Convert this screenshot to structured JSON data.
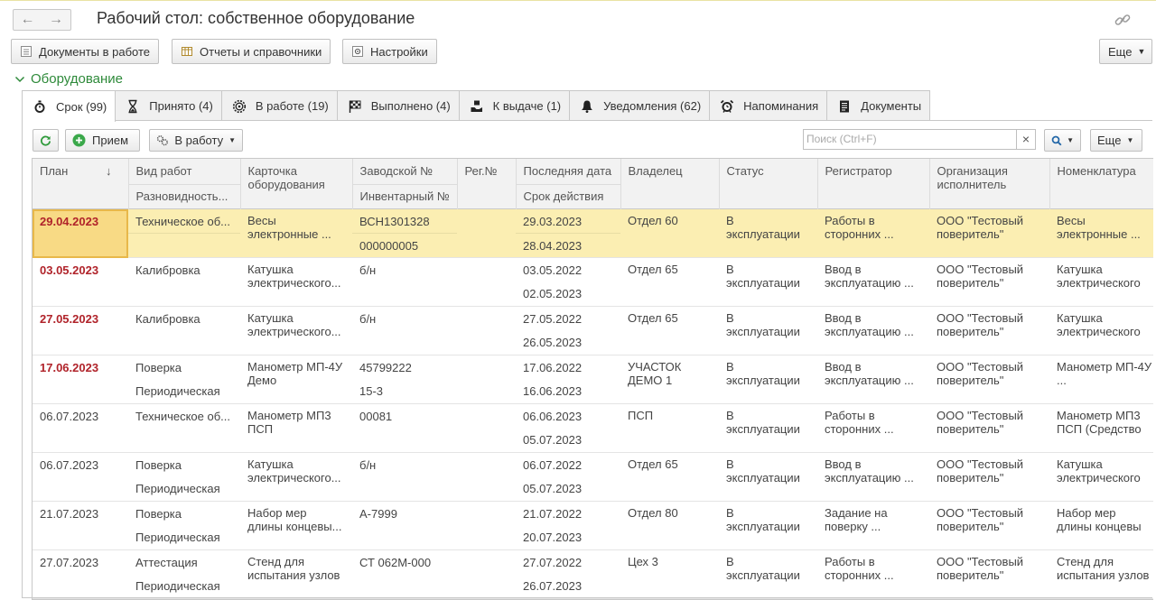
{
  "window": {
    "title": "Рабочий стол: собственное оборудование"
  },
  "toolbar": {
    "docs_in_work": "Документы в работе",
    "reports": "Отчеты и справочники",
    "settings": "Настройки",
    "more": "Еще"
  },
  "section": {
    "title": "Оборудование"
  },
  "tabs": [
    {
      "label": "Срок (99)",
      "icon": "stopwatch-icon"
    },
    {
      "label": "Принято (4)",
      "icon": "hourglass-icon"
    },
    {
      "label": "В работе (19)",
      "icon": "gear-icon"
    },
    {
      "label": "Выполнено (4)",
      "icon": "checkered-flag-icon"
    },
    {
      "label": "К выдаче (1)",
      "icon": "handover-icon"
    },
    {
      "label": "Уведомления (62)",
      "icon": "bell-icon"
    },
    {
      "label": "Напоминания",
      "icon": "alarm-clock-icon"
    },
    {
      "label": "Документы",
      "icon": "document-icon"
    }
  ],
  "panel_toolbar": {
    "receive": "Прием",
    "to_work": "В работу",
    "search_placeholder": "Поиск (Ctrl+F)",
    "search_clear": "×",
    "more": "Еще"
  },
  "columns": {
    "plan": "План",
    "work_type": "Вид работ",
    "work_variety": "Разновидность...",
    "card": "Карточка оборудования",
    "serial": "Заводской №",
    "inventory": "Инвентарный №",
    "reg": "Рег.№",
    "last_date": "Последняя дата",
    "validity": "Срок действия",
    "owner": "Владелец",
    "status": "Статус",
    "registrar": "Регистратор",
    "org": "Организация исполнитель",
    "nomenclature": "Номенклатура"
  },
  "rows": [
    {
      "plan": "29.04.2023",
      "overdue": true,
      "work_type": "Техническое об...",
      "variety": "",
      "card": "Весы электронные ...",
      "serial": "ВСН1301328",
      "inventory": "000000005",
      "reg": "",
      "last_date": "29.03.2023",
      "validity": "28.04.2023",
      "owner": "Отдел 60",
      "status": "В эксплуатации",
      "registrar": "Работы в сторонних ...",
      "org": "ООО \"Тестовый поверитель\"",
      "nomenclature": "Весы электронные ..."
    },
    {
      "plan": "03.05.2023",
      "overdue": true,
      "work_type": "Калибровка",
      "variety": "",
      "card": "Катушка электрического...",
      "serial": "б/н",
      "inventory": "",
      "reg": "",
      "last_date": "03.05.2022",
      "validity": "02.05.2023",
      "owner": "Отдел 65",
      "status": "В эксплуатации",
      "registrar": "Ввод в эксплуатацию ...",
      "org": "ООО \"Тестовый поверитель\"",
      "nomenclature": "Катушка электрического"
    },
    {
      "plan": "27.05.2023",
      "overdue": true,
      "work_type": "Калибровка",
      "variety": "",
      "card": "Катушка электрического...",
      "serial": "б/н",
      "inventory": "",
      "reg": "",
      "last_date": "27.05.2022",
      "validity": "26.05.2023",
      "owner": "Отдел 65",
      "status": "В эксплуатации",
      "registrar": "Ввод в эксплуатацию ...",
      "org": "ООО \"Тестовый поверитель\"",
      "nomenclature": "Катушка электрического"
    },
    {
      "plan": "17.06.2023",
      "overdue": true,
      "work_type": "Поверка",
      "variety": "Периодическая",
      "card": "Манометр МП-4У Демо",
      "serial": "45799222",
      "inventory": "15-3",
      "reg": "",
      "last_date": "17.06.2022",
      "validity": "16.06.2023",
      "owner": "УЧАСТОК ДЕМО 1",
      "status": "В эксплуатации",
      "registrar": "Ввод в эксплуатацию ...",
      "org": "ООО \"Тестовый поверитель\"",
      "nomenclature": "Манометр МП-4У ..."
    },
    {
      "plan": "06.07.2023",
      "overdue": false,
      "work_type": "Техническое об...",
      "variety": "",
      "card": "Манометр МП3 ПСП",
      "serial": "00081",
      "inventory": "",
      "reg": "",
      "last_date": "06.06.2023",
      "validity": "05.07.2023",
      "owner": "ПСП",
      "status": "В эксплуатации",
      "registrar": "Работы в сторонних ...",
      "org": "ООО \"Тестовый поверитель\"",
      "nomenclature": "Манометр МП3 ПСП (Средство"
    },
    {
      "plan": "06.07.2023",
      "overdue": false,
      "work_type": "Поверка",
      "variety": "Периодическая",
      "card": "Катушка электрического...",
      "serial": "б/н",
      "inventory": "",
      "reg": "",
      "last_date": "06.07.2022",
      "validity": "05.07.2023",
      "owner": "Отдел 65",
      "status": "В эксплуатации",
      "registrar": "Ввод в эксплуатацию ...",
      "org": "ООО \"Тестовый поверитель\"",
      "nomenclature": "Катушка электрического"
    },
    {
      "plan": "21.07.2023",
      "overdue": false,
      "work_type": "Поверка",
      "variety": "Периодическая",
      "card": "Набор мер длины концевы...",
      "serial": "А-7999",
      "inventory": "",
      "reg": "",
      "last_date": "21.07.2022",
      "validity": "20.07.2023",
      "owner": "Отдел 80",
      "status": "В эксплуатации",
      "registrar": "Задание на поверку ...",
      "org": "ООО \"Тестовый поверитель\"",
      "nomenclature": "Набор мер длины концевы"
    },
    {
      "plan": "27.07.2023",
      "overdue": false,
      "work_type": "Аттестация",
      "variety": "Периодическая",
      "card": "Стенд для испытания узлов",
      "serial": "СТ 062М-000",
      "inventory": "",
      "reg": "",
      "last_date": "27.07.2022",
      "validity": "26.07.2023",
      "owner": "Цех 3",
      "status": "В эксплуатации",
      "registrar": "Работы в сторонних ...",
      "org": "ООО \"Тестовый поверитель\"",
      "nomenclature": "Стенд для испытания узлов"
    }
  ],
  "colors": {
    "overdue": "#b0232a",
    "selected_row": "#fbeeb2",
    "section_green": "#2e8a3a"
  }
}
